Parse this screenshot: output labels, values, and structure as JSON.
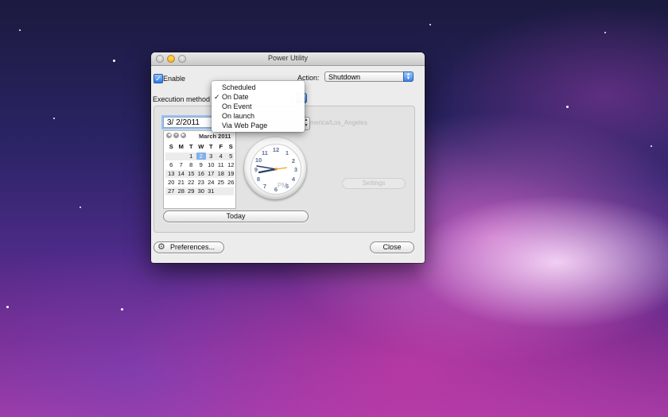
{
  "window": {
    "title": "Power Utility"
  },
  "enable": {
    "label": "Enable",
    "checked": true
  },
  "action": {
    "label": "Action:",
    "value": "Shutdown"
  },
  "execution": {
    "label": "Execution method"
  },
  "menu": {
    "items": [
      "Scheduled",
      "On Date",
      "On Event",
      "On launch",
      "Via Web Page"
    ],
    "checked_index": 1,
    "check_mark": "✓"
  },
  "hidden_behind": {
    "timezone_text": "America/Los_Angeles",
    "settings_label": "Settings"
  },
  "date": {
    "value": "3/  2/2011"
  },
  "calendar": {
    "month": "March 2011",
    "dow": [
      "S",
      "M",
      "T",
      "W",
      "T",
      "F",
      "S"
    ],
    "weeks": [
      [
        "",
        "",
        "1",
        "2",
        "3",
        "4",
        "5"
      ],
      [
        "6",
        "7",
        "8",
        "9",
        "10",
        "11",
        "12"
      ],
      [
        "13",
        "14",
        "15",
        "16",
        "17",
        "18",
        "19"
      ],
      [
        "20",
        "21",
        "22",
        "23",
        "24",
        "25",
        "26"
      ],
      [
        "27",
        "28",
        "29",
        "30",
        "31",
        "",
        ""
      ]
    ],
    "selected_day": "2"
  },
  "clock": {
    "numbers": [
      "12",
      "1",
      "2",
      "3",
      "4",
      "5",
      "6",
      "7",
      "8",
      "9",
      "10",
      "11"
    ],
    "meridiem": "PM"
  },
  "buttons": {
    "today": "Today",
    "preferences": "Preferences...",
    "close": "Close"
  },
  "icons": {
    "gear": "gear-icon",
    "checkmark": "checkmark-icon"
  },
  "colors": {
    "accent": "#3d83e6",
    "selection": "#7fb1ee"
  }
}
